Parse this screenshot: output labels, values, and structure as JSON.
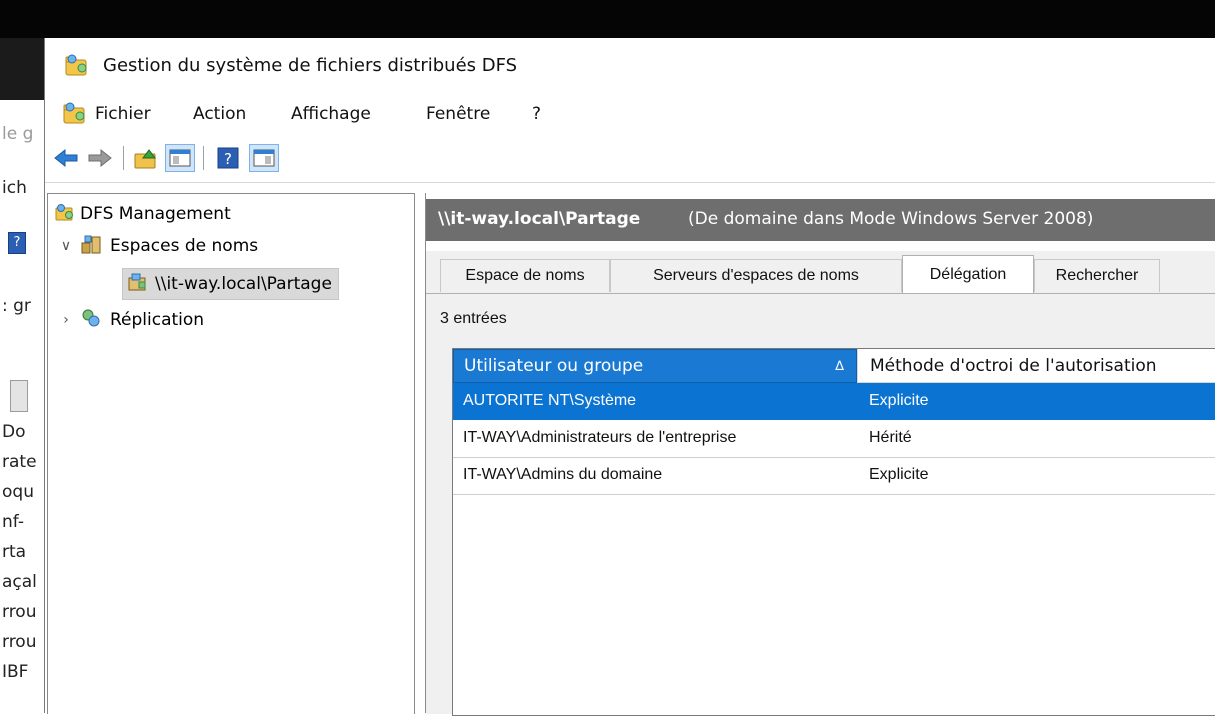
{
  "window": {
    "title": "Gestion du système de fichiers distribués DFS"
  },
  "menubar": {
    "items": [
      "Fichier",
      "Action",
      "Affichage",
      "Fenêtre",
      "?"
    ]
  },
  "toolbar": {
    "buttons": [
      "back-icon",
      "forward-icon",
      "up-folder-icon",
      "show-hide-tree-icon",
      "help-icon",
      "show-hide-action-pane-icon"
    ]
  },
  "background_window": {
    "fragments": [
      "le g",
      "ich",
      ": gr",
      "Do",
      "rate",
      "oqu",
      "nf-",
      "rta",
      "açal",
      "rrou",
      "rrou",
      "IBF"
    ]
  },
  "tree": {
    "root": "DFS Management",
    "namespaces": "Espaces de noms",
    "namespace_item": "\\\\it-way.local\\Partage",
    "replication": "Réplication"
  },
  "details": {
    "header_path": "\\\\it-way.local\\Partage",
    "header_subtitle": "(De domaine dans Mode Windows Server 2008)",
    "tabs": [
      "Espace de noms",
      "Serveurs d'espaces de noms",
      "Délégation",
      "Rechercher"
    ],
    "active_tab": "Délégation",
    "entry_count": "3 entrées",
    "columns": [
      "Utilisateur ou groupe",
      "Méthode d'octroi de l'autorisation"
    ],
    "sort_indicator": "∆",
    "rows": [
      {
        "user": "AUTORITE NT\\Système",
        "method": "Explicite"
      },
      {
        "user": "IT-WAY\\Administrateurs de l'entreprise",
        "method": "Hérité"
      },
      {
        "user": "IT-WAY\\Admins du domaine",
        "method": "Explicite"
      }
    ]
  },
  "colors": {
    "selection_blue": "#0b73d2",
    "header_gray": "#6e6e6e",
    "column_header_blue": "#1979d3"
  }
}
